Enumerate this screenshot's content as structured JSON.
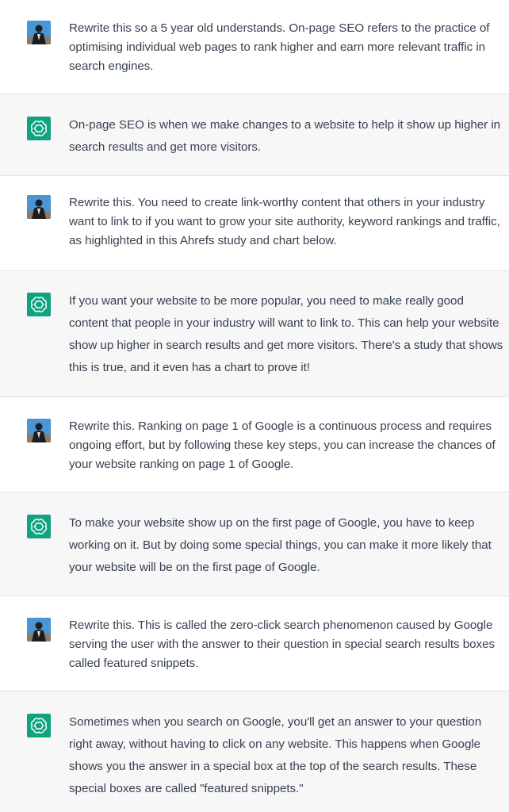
{
  "messages": [
    {
      "role": "user",
      "text": "Rewrite this so a 5 year old understands. On-page SEO refers to the practice of optimising individual web pages to rank higher and earn more relevant traffic in search engines."
    },
    {
      "role": "assistant",
      "text": "On-page SEO is when we make changes to a website to help it show up higher in search results and get more visitors."
    },
    {
      "role": "user",
      "text": "Rewrite this. You need to create link-worthy content that others in your industry want to link to if you want to grow your site authority, keyword rankings and traffic, as highlighted in this Ahrefs study and chart below."
    },
    {
      "role": "assistant",
      "text": "If you want your website to be more popular, you need to make really good content that people in your industry will want to link to. This can help your website show up higher in search results and get more visitors. There's a study that shows this is true, and it even has a chart to prove it!"
    },
    {
      "role": "user",
      "text": "Rewrite this. Ranking on page 1 of Google is a continuous process and requires ongoing effort, but by following these key steps, you can increase the chances of your website ranking on page 1 of Google."
    },
    {
      "role": "assistant",
      "text": "To make your website show up on the first page of Google, you have to keep working on it. But by doing some special things, you can make it more likely that your website will be on the first page of Google."
    },
    {
      "role": "user",
      "text": "Rewrite this. This is called the zero-click search phenomenon caused by Google serving the user with the answer to their question in special search results boxes called featured snippets."
    },
    {
      "role": "assistant",
      "text": "Sometimes when you search on Google, you'll get an answer to your question right away, without having to click on any website. This happens when Google shows you the answer in a special box at the top of the search results. These special boxes are called \"featured snippets.\""
    }
  ],
  "colors": {
    "assistant_bg": "#f7f7f8",
    "user_bg": "#ffffff",
    "assistant_avatar": "#10a37f",
    "user_avatar": "#3f8fd0",
    "text": "#374151"
  },
  "icons": {
    "user_avatar": "user-photo-avatar",
    "assistant_avatar": "openai-logo-icon"
  }
}
